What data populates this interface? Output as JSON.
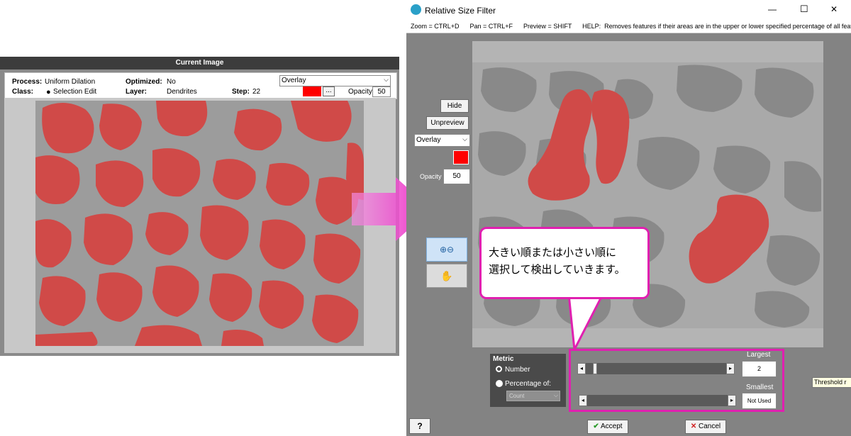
{
  "left_window": {
    "title": "Current Image",
    "process_label": "Process:",
    "process_value": "Uniform Dilation",
    "optimized_label": "Optimized:",
    "optimized_value": "No",
    "class_label": "Class:",
    "class_value": "Selection Edit",
    "layer_label": "Layer:",
    "layer_value": "Dendrites",
    "step_label": "Step:",
    "step_value": "22",
    "display_mode": "Overlay",
    "ellipsis_label": "...",
    "opacity_label": "Opacity:",
    "opacity_value": "50",
    "overlay_color": "#ff0000"
  },
  "right_window": {
    "title": "Relative Size Filter",
    "help_line": "Zoom = CTRL+D      Pan = CTRL+F      Preview = SHIFT      HELP:  Removes features if their areas are in the upper or lower specified percentage of all feature ar",
    "hide_label": "Hide",
    "unpreview_label": "Unpreview",
    "display_mode": "Overlay",
    "opacity_label": "Opacity",
    "opacity_value": "50",
    "overlay_color": "#ff0000",
    "metric_title": "Metric",
    "metric_number": "Number",
    "metric_percentage": "Percentage of:",
    "metric_select": "Count",
    "largest_label": "Largest",
    "largest_value": "2",
    "smallest_label": "Smallest",
    "smallest_value": "Not Used",
    "accept_label": "Accept",
    "cancel_label": "Cancel",
    "help_button": "?",
    "tooltip": "Threshold r",
    "minimize_glyph": "—",
    "maximize_glyph": "☐",
    "close_glyph": "✕"
  },
  "callout": {
    "line1": "大きい順または小さい順に",
    "line2": "選択して検出していきます。"
  },
  "colors": {
    "overlay_red": "#d04a48",
    "callout_border": "#e020b0",
    "arrow": "#ee3fc9"
  }
}
